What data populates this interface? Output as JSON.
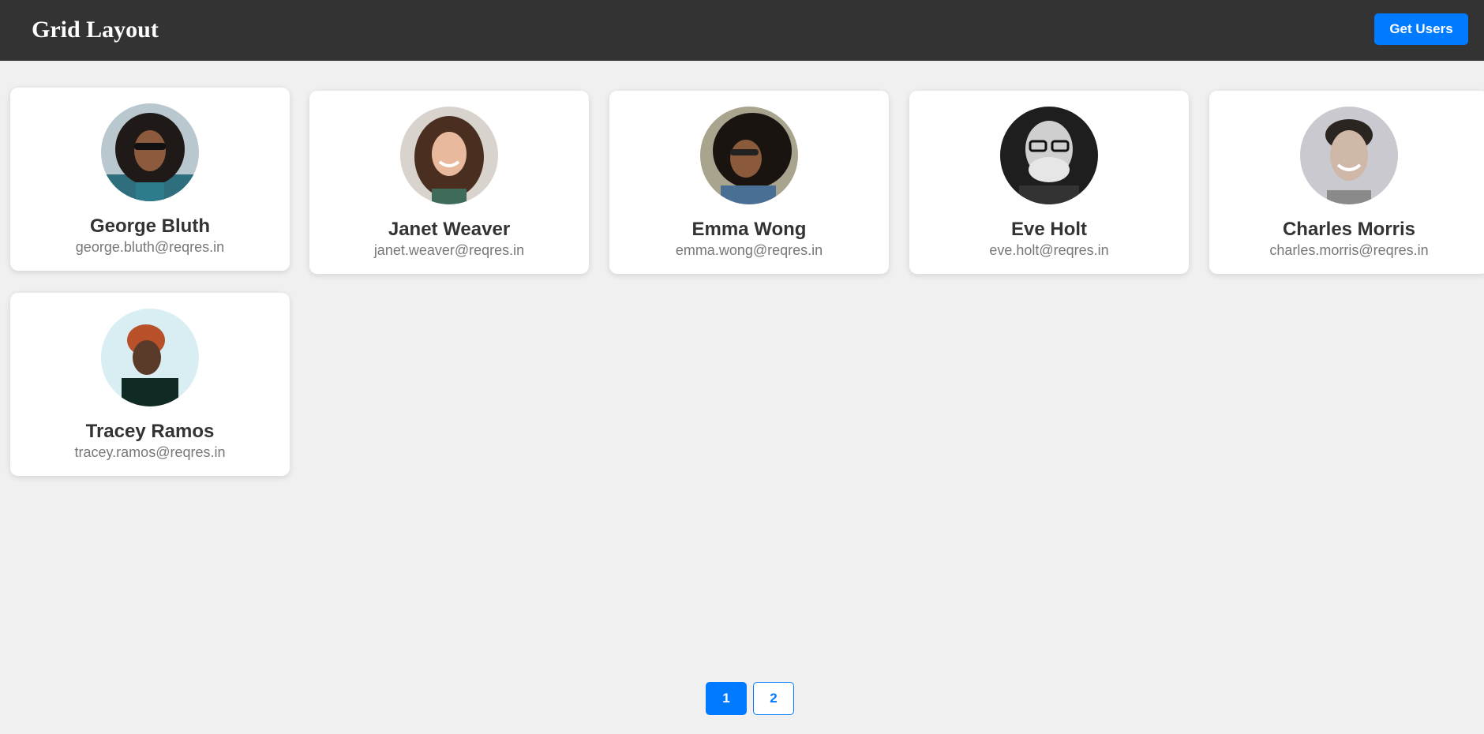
{
  "header": {
    "title": "Grid Layout",
    "get_users_label": "Get Users"
  },
  "users": [
    {
      "name": "George Bluth",
      "email": "george.bluth@reqres.in"
    },
    {
      "name": "Janet Weaver",
      "email": "janet.weaver@reqres.in"
    },
    {
      "name": "Emma Wong",
      "email": "emma.wong@reqres.in"
    },
    {
      "name": "Eve Holt",
      "email": "eve.holt@reqres.in"
    },
    {
      "name": "Charles Morris",
      "email": "charles.morris@reqres.in"
    },
    {
      "name": "Tracey Ramos",
      "email": "tracey.ramos@reqres.in"
    }
  ],
  "pagination": {
    "pages": [
      "1",
      "2"
    ],
    "current": "1"
  },
  "colors": {
    "navbar": "#333333",
    "accent": "#007bff",
    "background": "#f0f0f0"
  }
}
